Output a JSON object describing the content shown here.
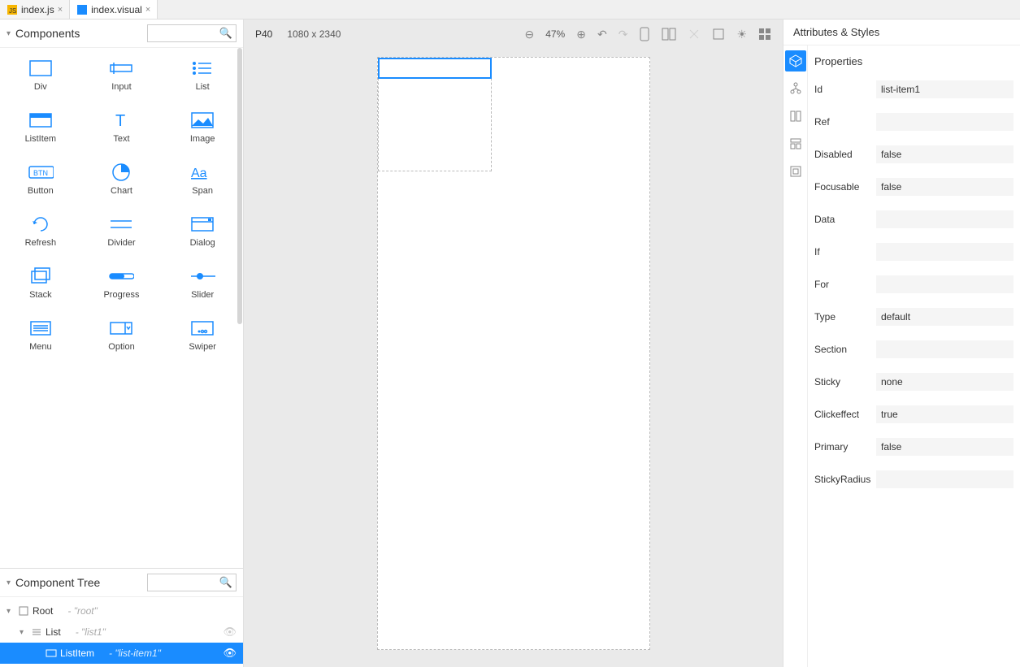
{
  "tabs": [
    {
      "label": "index.js"
    },
    {
      "label": "index.visual"
    }
  ],
  "left": {
    "components_title": "Components",
    "tree_title": "Component Tree",
    "items": {
      "div": "Div",
      "input": "Input",
      "list": "List",
      "listitem": "ListItem",
      "text": "Text",
      "image": "Image",
      "button": "Button",
      "chart": "Chart",
      "span": "Span",
      "refresh": "Refresh",
      "divider": "Divider",
      "dialog": "Dialog",
      "stack": "Stack",
      "progress": "Progress",
      "slider": "Slider",
      "menu": "Menu",
      "option": "Option",
      "swiper": "Swiper"
    },
    "tree": {
      "root": {
        "name": "Root",
        "id": "- \"root\""
      },
      "list": {
        "name": "List",
        "id": "- \"list1\""
      },
      "listitem": {
        "name": "ListItem",
        "id": "- \"list-item1\""
      }
    }
  },
  "canvas": {
    "device": "P40",
    "dimensions": "1080 x 2340",
    "zoom": "47%"
  },
  "right": {
    "title": "Attributes & Styles",
    "section": "Properties",
    "fields": {
      "id": {
        "label": "Id",
        "value": "list-item1"
      },
      "ref": {
        "label": "Ref",
        "value": ""
      },
      "disabled": {
        "label": "Disabled",
        "value": "false"
      },
      "focusable": {
        "label": "Focusable",
        "value": "false"
      },
      "data": {
        "label": "Data",
        "value": ""
      },
      "if": {
        "label": "If",
        "value": ""
      },
      "for": {
        "label": "For",
        "value": ""
      },
      "type": {
        "label": "Type",
        "value": "default"
      },
      "section": {
        "label": "Section",
        "value": ""
      },
      "sticky": {
        "label": "Sticky",
        "value": "none"
      },
      "clickeffect": {
        "label": "Clickeffect",
        "value": "true"
      },
      "primary": {
        "label": "Primary",
        "value": "false"
      },
      "stickyradius": {
        "label": "StickyRadius",
        "value": ""
      }
    }
  }
}
